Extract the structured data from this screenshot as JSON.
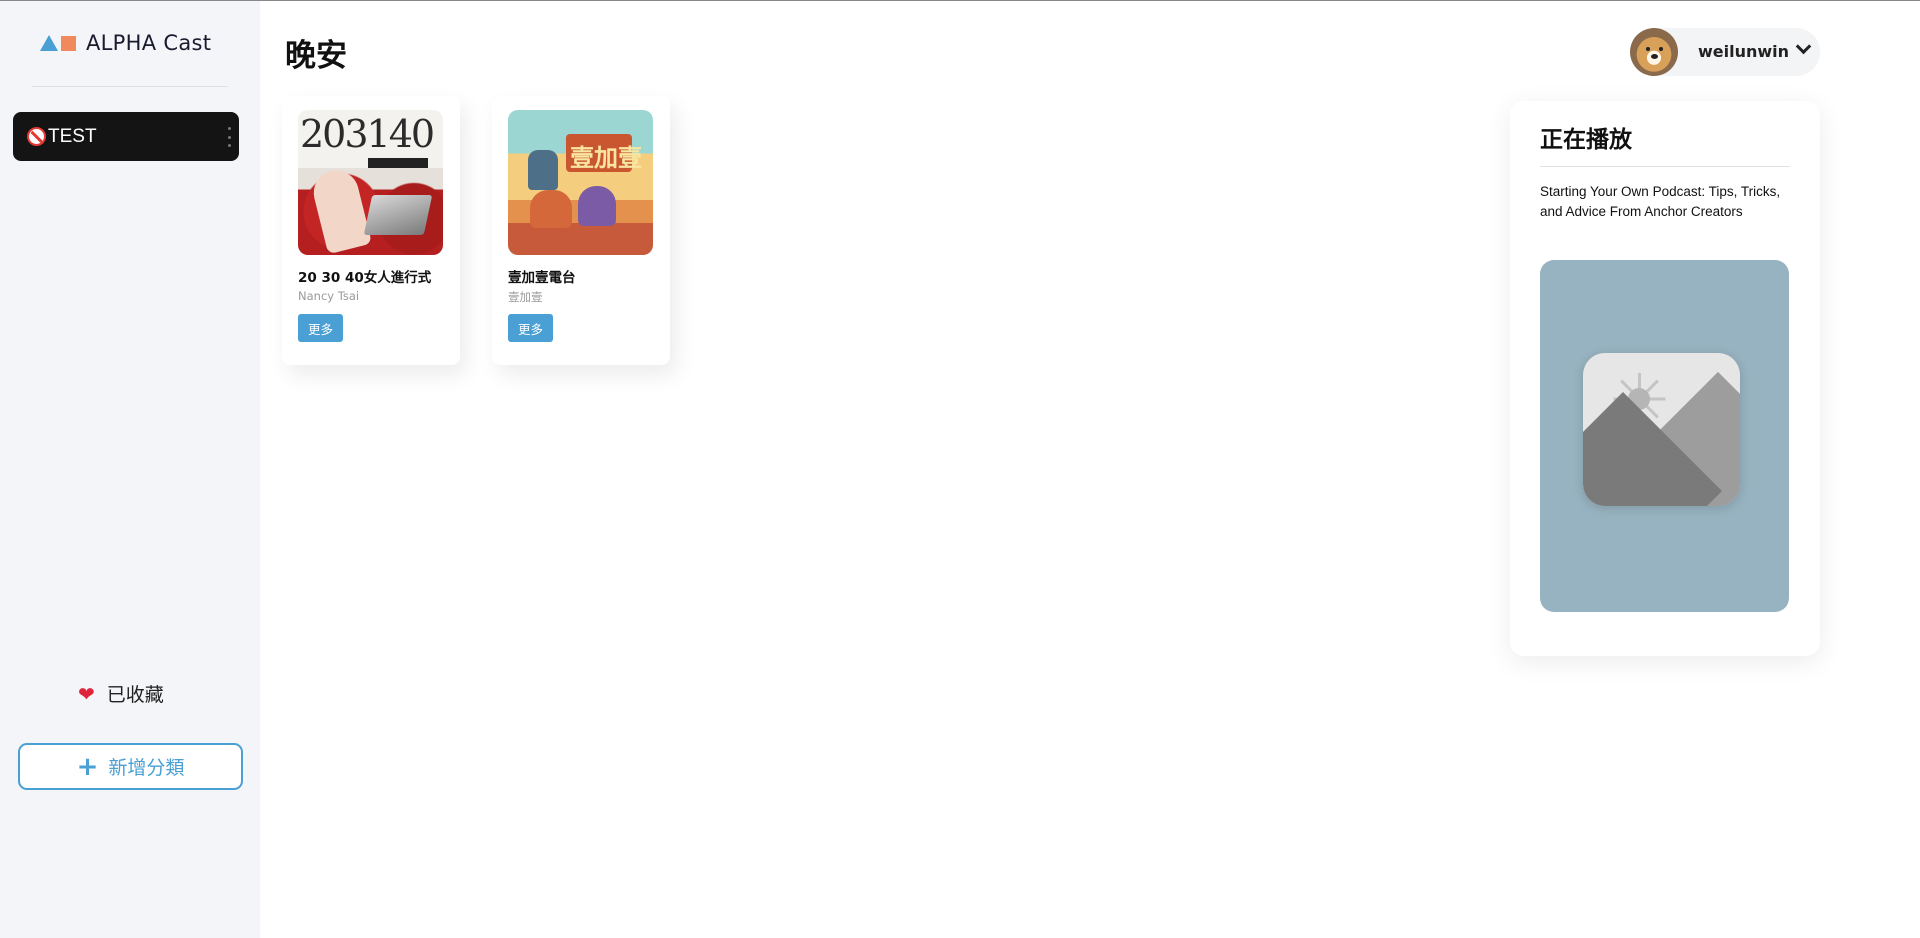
{
  "sidebar": {
    "brand": "ALPHA Cast",
    "categories": [
      {
        "label": "TEST"
      }
    ],
    "favorites_label": "已收藏",
    "add_category_label": "新增分類"
  },
  "main": {
    "greeting": "晚安",
    "podcasts": [
      {
        "title": "20 30 40女人進行式",
        "author": "Nancy Tsai",
        "more_label": "更多",
        "cover_text": "203140"
      },
      {
        "title": "壹加壹電台",
        "author": "壹加壹",
        "more_label": "更多",
        "cover_text": "壹加壹"
      }
    ]
  },
  "user": {
    "name": "weilunwin"
  },
  "now_playing": {
    "heading": "正在播放",
    "episode_title": "Starting Your Own Podcast: Tips, Tricks, and Advice From Anchor Creators"
  },
  "colors": {
    "accent": "#4a9fd4",
    "logo_square": "#f08a5d",
    "active_category_bg": "#141414",
    "artwork_bg": "#97b2c0"
  }
}
